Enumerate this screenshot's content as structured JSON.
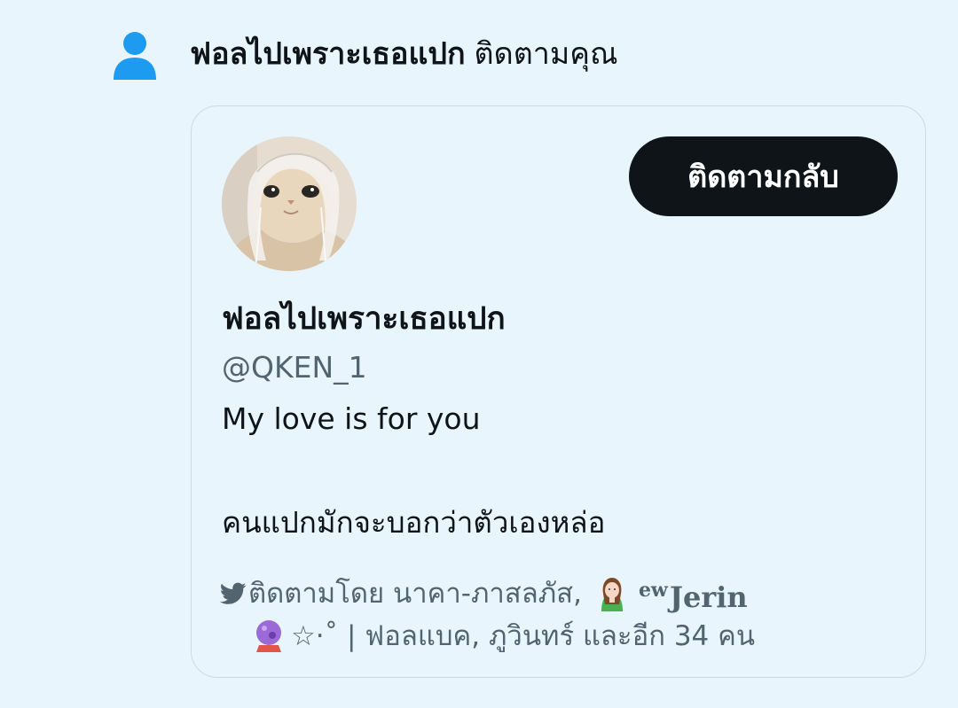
{
  "notification": {
    "icon": "person-icon",
    "name": "ฟอลไปเพราะเธอแปก",
    "suffix": "ติดตามคุณ"
  },
  "profile_card": {
    "follow_back_label": "ติดตามกลับ",
    "display_name": "ฟอลไปเพราะเธอแปก",
    "handle": "@QKEN_1",
    "bio_line1": "My love is for you",
    "bio_line2": "คนแปกมักจะบอกว่าตัวเองหล่อ",
    "followed_by": {
      "prefix": "ติดตามโดย นาคา-ภาสลภัส,",
      "user2_sup": "ew",
      "user2_name": "Jerin",
      "user2_tail": "☆⋅˚ | ฟอลแบค,",
      "rest": "ภูวินทร์ และอีก 34 คน"
    }
  },
  "colors": {
    "background": "#e8f5fd",
    "accent_blue": "#1d9bf0",
    "button_bg": "#0f1419",
    "secondary_text": "#536471",
    "border": "#cfd9de"
  }
}
